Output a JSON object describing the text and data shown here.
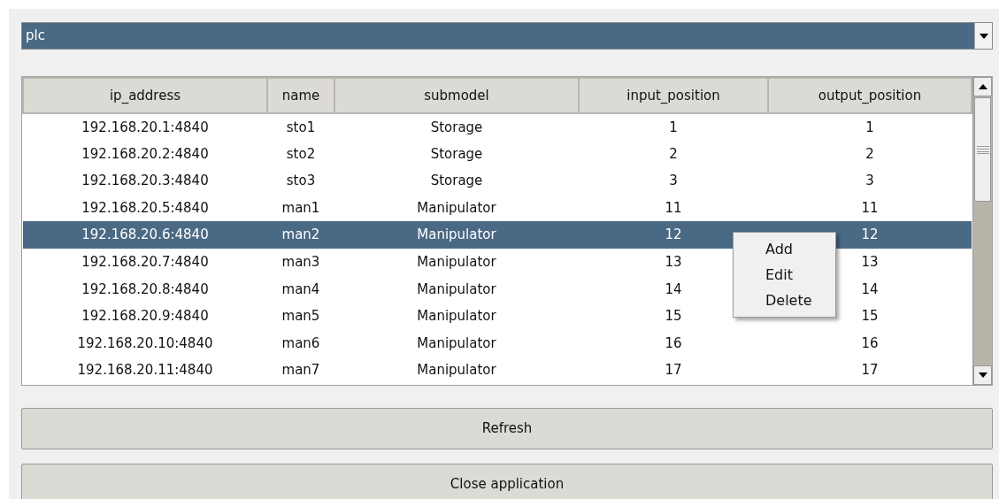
{
  "combo": {
    "value": "plc"
  },
  "table": {
    "columns": [
      "ip_address",
      "name",
      "submodel",
      "input_position",
      "output_position"
    ],
    "rows": [
      {
        "cells": [
          "192.168.20.1:4840",
          "sto1",
          "Storage",
          "1",
          "1"
        ],
        "selected": false
      },
      {
        "cells": [
          "192.168.20.2:4840",
          "sto2",
          "Storage",
          "2",
          "2"
        ],
        "selected": false
      },
      {
        "cells": [
          "192.168.20.3:4840",
          "sto3",
          "Storage",
          "3",
          "3"
        ],
        "selected": false
      },
      {
        "cells": [
          "192.168.20.5:4840",
          "man1",
          "Manipulator",
          "11",
          "11"
        ],
        "selected": false
      },
      {
        "cells": [
          "192.168.20.6:4840",
          "man2",
          "Manipulator",
          "12",
          "12"
        ],
        "selected": true
      },
      {
        "cells": [
          "192.168.20.7:4840",
          "man3",
          "Manipulator",
          "13",
          "13"
        ],
        "selected": false
      },
      {
        "cells": [
          "192.168.20.8:4840",
          "man4",
          "Manipulator",
          "14",
          "14"
        ],
        "selected": false
      },
      {
        "cells": [
          "192.168.20.9:4840",
          "man5",
          "Manipulator",
          "15",
          "15"
        ],
        "selected": false
      },
      {
        "cells": [
          "192.168.20.10:4840",
          "man6",
          "Manipulator",
          "16",
          "16"
        ],
        "selected": false
      },
      {
        "cells": [
          "192.168.20.11:4840",
          "man7",
          "Manipulator",
          "17",
          "17"
        ],
        "selected": false
      }
    ]
  },
  "context_menu": {
    "items": [
      "Add",
      "Edit",
      "Delete"
    ]
  },
  "buttons": [
    "Refresh",
    "Close application"
  ]
}
